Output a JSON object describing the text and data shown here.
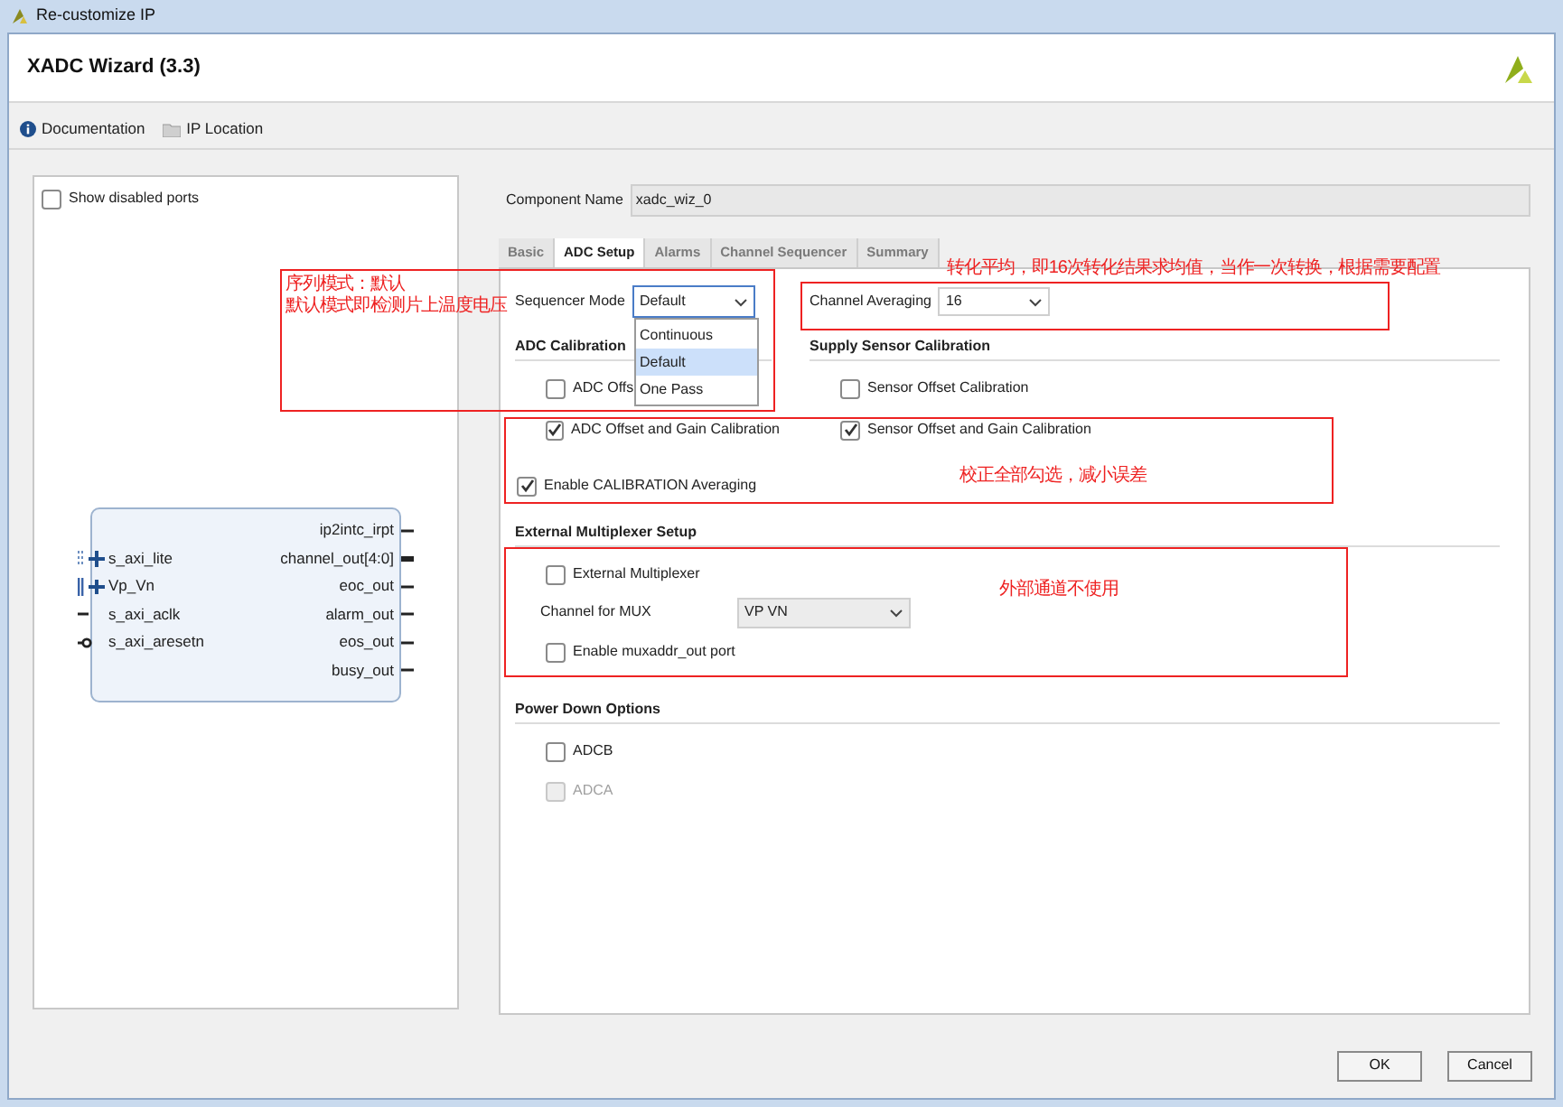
{
  "window": {
    "title": "Re-customize IP"
  },
  "header": {
    "title": "XADC Wizard (3.3)"
  },
  "toolbar": [
    {
      "label": "Documentation",
      "kind": "info"
    },
    {
      "label": "IP Location",
      "kind": "folder"
    }
  ],
  "left_panel": {
    "show_disabled_ports": {
      "label": "Show disabled ports",
      "checked": false
    },
    "left_ports": [
      {
        "name": "s_axi_lite",
        "kind": "bus"
      },
      {
        "name": "Vp_Vn",
        "kind": "diff"
      },
      {
        "name": "s_axi_aclk",
        "kind": "wire"
      },
      {
        "name": "s_axi_aresetn",
        "kind": "reset"
      }
    ],
    "right_ports": [
      {
        "name": "ip2intc_irpt",
        "kind": "wire"
      },
      {
        "name": "channel_out[4:0]",
        "kind": "bus"
      },
      {
        "name": "eoc_out",
        "kind": "wire"
      },
      {
        "name": "alarm_out",
        "kind": "wire"
      },
      {
        "name": "eos_out",
        "kind": "wire"
      },
      {
        "name": "busy_out",
        "kind": "wire"
      }
    ]
  },
  "component_name": {
    "label": "Component Name",
    "value": "xadc_wiz_0"
  },
  "tabs": [
    {
      "label": "Basic",
      "selected": false
    },
    {
      "label": "ADC Setup",
      "selected": true
    },
    {
      "label": "Alarms",
      "selected": false
    },
    {
      "label": "Channel Sequencer",
      "selected": false
    },
    {
      "label": "Summary",
      "selected": false
    }
  ],
  "sequencer_mode": {
    "label": "Sequencer Mode",
    "value": "Default",
    "expanded": true,
    "options": [
      {
        "label": "Continuous",
        "selected": false
      },
      {
        "label": "Default",
        "selected": true
      },
      {
        "label": "One Pass",
        "selected": false
      }
    ]
  },
  "channel_averaging": {
    "label": "Channel Averaging",
    "value": "16"
  },
  "adc_calibration": {
    "title": "ADC Calibration",
    "items": [
      {
        "label": "ADC Offs",
        "checked": false
      },
      {
        "label": "ADC Offset and Gain Calibration",
        "checked": true
      }
    ]
  },
  "supply_sensor_calibration": {
    "title": "Supply Sensor Calibration",
    "items": [
      {
        "label": "Sensor Offset Calibration",
        "checked": false
      },
      {
        "label": "Sensor Offset and Gain Calibration",
        "checked": true
      }
    ]
  },
  "enable_calibration_averaging": {
    "label": "Enable CALIBRATION Averaging",
    "checked": true
  },
  "external_multiplexer_setup": {
    "title": "External Multiplexer Setup",
    "external_multiplexer": {
      "label": "External Multiplexer",
      "checked": false
    },
    "channel_for_mux": {
      "label": "Channel for MUX",
      "value": "VP VN"
    },
    "enable_muxaddr_out": {
      "label": "Enable muxaddr_out port",
      "checked": false
    }
  },
  "power_down_options": {
    "title": "Power Down Options",
    "items": [
      {
        "label": "ADCB",
        "checked": false,
        "disabled": false
      },
      {
        "label": "ADCA",
        "checked": false,
        "disabled": true
      }
    ]
  },
  "buttons": [
    {
      "label": "OK"
    },
    {
      "label": "Cancel"
    }
  ],
  "annotations": [
    {
      "lines": [
        "序列模式：默认",
        "默认模式即检测片上温度电压"
      ]
    },
    {
      "lines": [
        "转化平均，即16次转化结果求均值，当作一次转换，根据需要配置"
      ]
    },
    {
      "lines": [
        "校正全部勾选，减小误差"
      ]
    },
    {
      "lines": [
        "外部通道不使用"
      ]
    }
  ]
}
